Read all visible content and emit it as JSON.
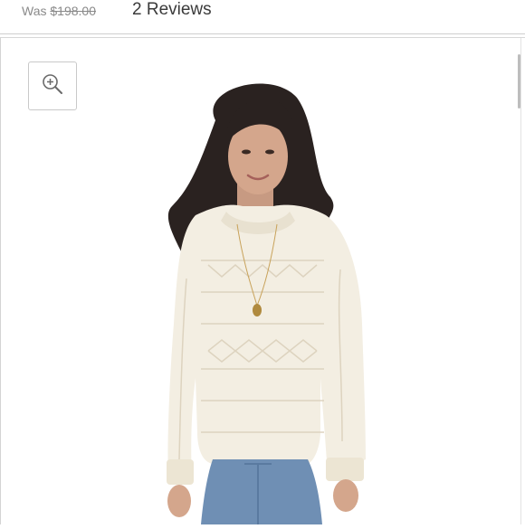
{
  "price": {
    "was_label": "Was",
    "was_value": "$198.00"
  },
  "reviews": {
    "label": "2 Reviews"
  },
  "icons": {
    "zoom": "zoom-in-icon"
  },
  "colors": {
    "sweater": "#f3eee2",
    "hair": "#2a2220",
    "denim": "#6f8fb4"
  }
}
